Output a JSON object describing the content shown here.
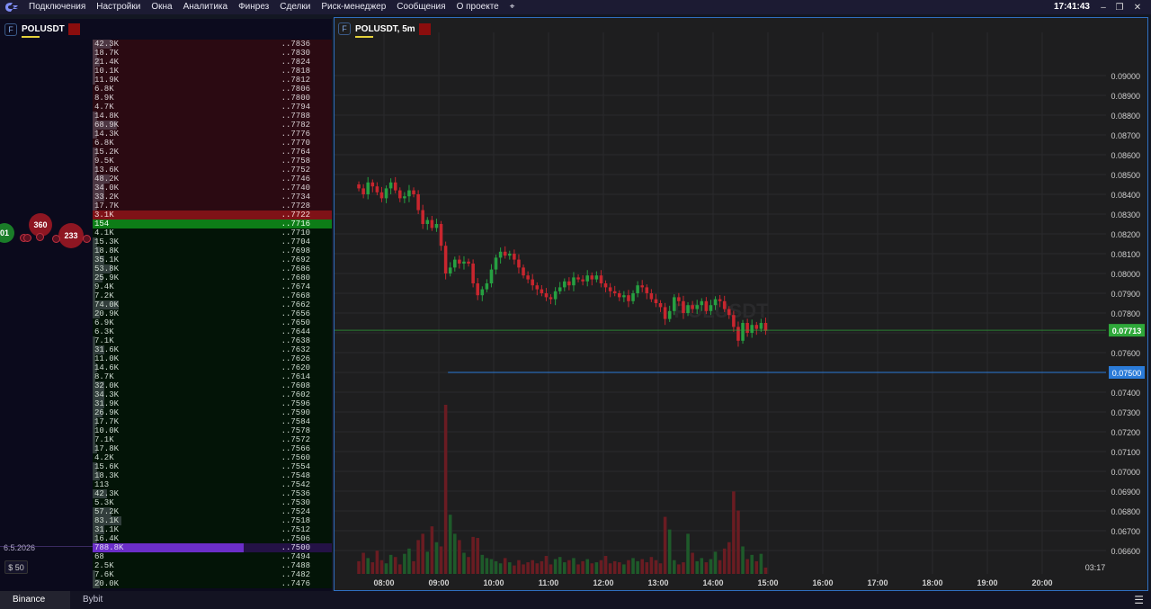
{
  "menu": {
    "items": [
      "Подключения",
      "Настройки",
      "Окна",
      "Аналитика",
      "Финрез",
      "Сделки",
      "Риск-менеджер",
      "Сообщения",
      "О проекте"
    ],
    "clock": "17:41:43"
  },
  "left": {
    "symbol": "POLUSDT",
    "badge": "F",
    "date": "6.5.2026",
    "qty_label": "$ 50",
    "bubbles": [
      {
        "label": "01",
        "color": "#1a7d28"
      },
      {
        "label": "360",
        "color": "#8e1622"
      },
      {
        "label": "233",
        "color": "#8e1622"
      }
    ],
    "ladder": [
      {
        "vol": "42.3K",
        "price": "..7836",
        "side": "ask",
        "fill": 0.08
      },
      {
        "vol": "18.7K",
        "price": "..7830",
        "side": "ask",
        "fill": 0.02
      },
      {
        "vol": "21.4K",
        "price": "..7824",
        "side": "ask",
        "fill": 0.03
      },
      {
        "vol": "10.1K",
        "price": "..7818",
        "side": "ask",
        "fill": 0.01
      },
      {
        "vol": "11.9K",
        "price": "..7812",
        "side": "ask",
        "fill": 0.01
      },
      {
        "vol": "6.8K",
        "price": "..7806",
        "side": "ask",
        "fill": 0.0
      },
      {
        "vol": "8.9K",
        "price": "..7800",
        "side": "ask",
        "fill": 0.0
      },
      {
        "vol": "4.7K",
        "price": "..7794",
        "side": "ask",
        "fill": 0.0
      },
      {
        "vol": "14.8K",
        "price": "..7788",
        "side": "ask",
        "fill": 0.02
      },
      {
        "vol": "68.9K",
        "price": "..7782",
        "side": "ask",
        "fill": 0.1
      },
      {
        "vol": "14.3K",
        "price": "..7776",
        "side": "ask",
        "fill": 0.02
      },
      {
        "vol": "6.8K",
        "price": "..7770",
        "side": "ask",
        "fill": 0.0
      },
      {
        "vol": "15.2K",
        "price": "..7764",
        "side": "ask",
        "fill": 0.02
      },
      {
        "vol": "9.5K",
        "price": "..7758",
        "side": "ask",
        "fill": 0.01
      },
      {
        "vol": "13.6K",
        "price": "..7752",
        "side": "ask",
        "fill": 0.02
      },
      {
        "vol": "48.2K",
        "price": "..7746",
        "side": "ask",
        "fill": 0.07
      },
      {
        "vol": "34.0K",
        "price": "..7740",
        "side": "ask",
        "fill": 0.05
      },
      {
        "vol": "33.2K",
        "price": "..7734",
        "side": "ask",
        "fill": 0.05
      },
      {
        "vol": "17.7K",
        "price": "..7728",
        "side": "ask",
        "fill": 0.02
      },
      {
        "vol": "3.1K",
        "price": "..7722",
        "side": "best-ask",
        "fill": 0.0
      },
      {
        "vol": "154",
        "price": "..7716",
        "side": "best-bid",
        "fill": 0.0
      },
      {
        "vol": "4.1K",
        "price": "..7710",
        "side": "bid",
        "fill": 0.0
      },
      {
        "vol": "15.3K",
        "price": "..7704",
        "side": "bid",
        "fill": 0.02
      },
      {
        "vol": "18.8K",
        "price": "..7698",
        "side": "bid",
        "fill": 0.03
      },
      {
        "vol": "35.1K",
        "price": "..7692",
        "side": "bid",
        "fill": 0.05
      },
      {
        "vol": "53.8K",
        "price": "..7686",
        "side": "bid",
        "fill": 0.08
      },
      {
        "vol": "25.9K",
        "price": "..7680",
        "side": "bid",
        "fill": 0.04
      },
      {
        "vol": "9.4K",
        "price": "..7674",
        "side": "bid",
        "fill": 0.01
      },
      {
        "vol": "7.2K",
        "price": "..7668",
        "side": "bid",
        "fill": 0.01
      },
      {
        "vol": "74.0K",
        "price": "..7662",
        "side": "bid",
        "fill": 0.11
      },
      {
        "vol": "20.9K",
        "price": "..7656",
        "side": "bid",
        "fill": 0.03
      },
      {
        "vol": "6.9K",
        "price": "..7650",
        "side": "bid",
        "fill": 0.0
      },
      {
        "vol": "6.3K",
        "price": "..7644",
        "side": "bid",
        "fill": 0.0
      },
      {
        "vol": "7.1K",
        "price": "..7638",
        "side": "bid",
        "fill": 0.01
      },
      {
        "vol": "31.6K",
        "price": "..7632",
        "side": "bid",
        "fill": 0.05
      },
      {
        "vol": "11.0K",
        "price": "..7626",
        "side": "bid",
        "fill": 0.01
      },
      {
        "vol": "14.6K",
        "price": "..7620",
        "side": "bid",
        "fill": 0.02
      },
      {
        "vol": "8.7K",
        "price": "..7614",
        "side": "bid",
        "fill": 0.01
      },
      {
        "vol": "32.0K",
        "price": "..7608",
        "side": "bid",
        "fill": 0.05
      },
      {
        "vol": "34.3K",
        "price": "..7602",
        "side": "bid",
        "fill": 0.05
      },
      {
        "vol": "31.9K",
        "price": "..7596",
        "side": "bid",
        "fill": 0.05
      },
      {
        "vol": "26.9K",
        "price": "..7590",
        "side": "bid",
        "fill": 0.04
      },
      {
        "vol": "17.7K",
        "price": "..7584",
        "side": "bid",
        "fill": 0.02
      },
      {
        "vol": "10.0K",
        "price": "..7578",
        "side": "bid",
        "fill": 0.01
      },
      {
        "vol": "7.1K",
        "price": "..7572",
        "side": "bid",
        "fill": 0.01
      },
      {
        "vol": "17.8K",
        "price": "..7566",
        "side": "bid",
        "fill": 0.02
      },
      {
        "vol": "4.2K",
        "price": "..7560",
        "side": "bid",
        "fill": 0.0
      },
      {
        "vol": "15.6K",
        "price": "..7554",
        "side": "bid",
        "fill": 0.02
      },
      {
        "vol": "18.3K",
        "price": "..7548",
        "side": "bid",
        "fill": 0.03
      },
      {
        "vol": "113",
        "price": "..7542",
        "side": "bid",
        "fill": 0.0
      },
      {
        "vol": "42.3K",
        "price": "..7536",
        "side": "bid",
        "fill": 0.06
      },
      {
        "vol": "5.3K",
        "price": "..7530",
        "side": "bid",
        "fill": 0.0
      },
      {
        "vol": "57.2K",
        "price": "..7524",
        "side": "bid",
        "fill": 0.08
      },
      {
        "vol": "83.1K",
        "price": "..7518",
        "side": "bid",
        "fill": 0.12
      },
      {
        "vol": "31.1K",
        "price": "..7512",
        "side": "bid",
        "fill": 0.05
      },
      {
        "vol": "16.4K",
        "price": "..7506",
        "side": "bid",
        "fill": 0.02
      },
      {
        "vol": "788.8K",
        "price": "..7500",
        "side": "big",
        "fill": 0.63
      },
      {
        "vol": "68",
        "price": "..7494",
        "side": "bid",
        "fill": 0.0
      },
      {
        "vol": "2.5K",
        "price": "..7488",
        "side": "bid",
        "fill": 0.0
      },
      {
        "vol": "7.6K",
        "price": "..7482",
        "side": "bid",
        "fill": 0.01
      },
      {
        "vol": "20.0K",
        "price": "..7476",
        "side": "bid",
        "fill": 0.03
      }
    ]
  },
  "chart": {
    "title": "POLUSDT, 5m",
    "badge": "F",
    "watermark": "POLUSDT",
    "last_price_label": "0.07713",
    "level_label": "0.07500",
    "countdown": "03:17",
    "colors": {
      "up": "#26a041",
      "down": "#c8262e",
      "level": "#2b7bd8",
      "last": "#2fa83a"
    }
  },
  "chart_data": {
    "type": "candlestick",
    "y_ticks": [
      "0.09000",
      "0.08900",
      "0.08800",
      "0.08700",
      "0.08600",
      "0.08500",
      "0.08400",
      "0.08300",
      "0.08200",
      "0.08100",
      "0.08000",
      "0.07900",
      "0.07800",
      "0.07700",
      "0.07600",
      "0.07500",
      "0.07400",
      "0.07300",
      "0.07200",
      "0.07100",
      "0.07000",
      "0.06900",
      "0.06800",
      "0.06700",
      "0.06600"
    ],
    "ylim": [
      0.0655,
      0.092
    ],
    "x_ticks": [
      "08:00",
      "09:00",
      "10:00",
      "11:00",
      "12:00",
      "13:00",
      "14:00",
      "15:00",
      "16:00",
      "17:00",
      "18:00",
      "19:00",
      "20:00"
    ],
    "start_time": "07:30",
    "interval_minutes": 5,
    "last_price": 0.07713,
    "level_price": 0.075,
    "level_start_time": "09:10",
    "closes": [
      0.0843,
      0.084,
      0.0846,
      0.0844,
      0.0841,
      0.0838,
      0.0843,
      0.0846,
      0.0842,
      0.0838,
      0.0839,
      0.0842,
      0.084,
      0.0832,
      0.0825,
      0.0827,
      0.0823,
      0.0825,
      0.0814,
      0.08,
      0.0803,
      0.0807,
      0.0805,
      0.0806,
      0.0805,
      0.0795,
      0.0789,
      0.0792,
      0.0795,
      0.0802,
      0.0808,
      0.0811,
      0.0809,
      0.081,
      0.0807,
      0.0803,
      0.0799,
      0.0797,
      0.0794,
      0.0792,
      0.079,
      0.0788,
      0.0787,
      0.0791,
      0.0793,
      0.0796,
      0.0794,
      0.0798,
      0.0797,
      0.0796,
      0.0799,
      0.0797,
      0.0799,
      0.0795,
      0.0793,
      0.0791,
      0.079,
      0.0788,
      0.0789,
      0.0786,
      0.079,
      0.0794,
      0.0793,
      0.079,
      0.0787,
      0.0785,
      0.0783,
      0.0777,
      0.0781,
      0.0788,
      0.0786,
      0.078,
      0.0784,
      0.0782,
      0.0784,
      0.0786,
      0.0781,
      0.0784,
      0.0787,
      0.0786,
      0.0782,
      0.0779,
      0.0773,
      0.0766,
      0.0775,
      0.077,
      0.0774,
      0.0772,
      0.0775,
      0.0771
    ],
    "volumes": [
      1.2,
      2.0,
      1.5,
      1.1,
      2.2,
      1.3,
      1.0,
      1.8,
      1.6,
      0.9,
      1.9,
      2.4,
      1.2,
      3.2,
      3.8,
      2.1,
      4.5,
      3.0,
      2.6,
      16.0,
      5.6,
      3.8,
      3.2,
      2.0,
      1.6,
      3.5,
      3.4,
      1.8,
      1.5,
      1.4,
      1.2,
      1.0,
      1.5,
      1.1,
      0.8,
      1.3,
      0.9,
      1.1,
      1.3,
      1.0,
      1.2,
      1.7,
      0.9,
      1.4,
      1.6,
      1.1,
      1.3,
      1.5,
      0.9,
      1.2,
      1.4,
      1.0,
      1.1,
      1.3,
      1.7,
      1.0,
      1.2,
      1.1,
      0.9,
      1.3,
      1.5,
      1.2,
      1.4,
      1.1,
      1.6,
      1.3,
      1.0,
      5.4,
      4.2,
      1.3,
      0.9,
      1.1,
      3.8,
      2.0,
      1.2,
      1.5,
      1.1,
      1.4,
      2.1,
      1.3,
      2.4,
      3.0,
      7.8,
      6.0,
      2.6,
      1.4,
      1.8,
      1.2,
      1.9,
      0.6
    ]
  },
  "bottom": {
    "tabs": [
      "Binance",
      "Bybit"
    ]
  }
}
